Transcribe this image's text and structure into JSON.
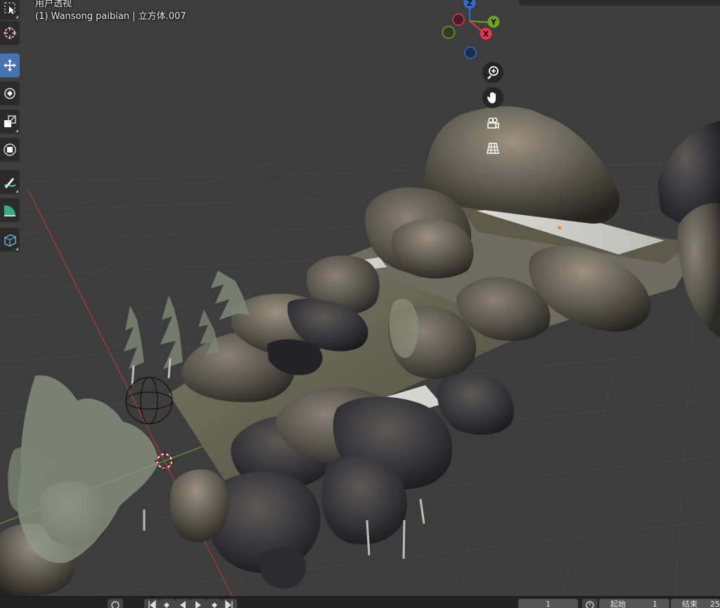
{
  "viewport": {
    "view_name": "用户透视",
    "object_name": "(1) Wansong paibian | 立方体.007"
  },
  "toolbar": {
    "tools": [
      {
        "name": "select-box-tool",
        "icon": "select-box-icon",
        "active": false
      },
      {
        "name": "cursor-tool",
        "icon": "cursor-icon",
        "active": false
      },
      {
        "name": "move-tool",
        "icon": "move-icon",
        "active": true
      },
      {
        "name": "rotate-tool",
        "icon": "rotate-icon",
        "active": false
      },
      {
        "name": "scale-tool",
        "icon": "scale-icon",
        "active": false
      },
      {
        "name": "transform-tool",
        "icon": "transform-icon",
        "active": false
      },
      {
        "name": "annotate-tool",
        "icon": "annotate-icon",
        "active": false
      },
      {
        "name": "measure-tool",
        "icon": "measure-icon",
        "active": false
      },
      {
        "name": "add-cube-tool",
        "icon": "add-cube-icon",
        "active": false
      }
    ]
  },
  "gizmo": {
    "axes": [
      {
        "label": "Z",
        "color": "#2f6bd4"
      },
      {
        "label": "Y",
        "color": "#6fa51f"
      },
      {
        "label": "X",
        "color": "#e8344e"
      }
    ]
  },
  "nav_buttons": [
    {
      "name": "zoom-button",
      "icon": "zoom-in-icon"
    },
    {
      "name": "pan-button",
      "icon": "hand-icon"
    },
    {
      "name": "camera-view-button",
      "icon": "camera-icon"
    },
    {
      "name": "ortho-toggle-button",
      "icon": "grid-icon"
    }
  ],
  "timeline": {
    "current_frame": "1",
    "start_label": "起始",
    "start_value": "1",
    "end_label": "结束",
    "end_value": "25"
  },
  "colors": {
    "background": "#3d3d3d",
    "active_tool": "#4772b3",
    "x_axis_line": "#b03a3a",
    "y_axis_line": "#5c8a2a"
  }
}
